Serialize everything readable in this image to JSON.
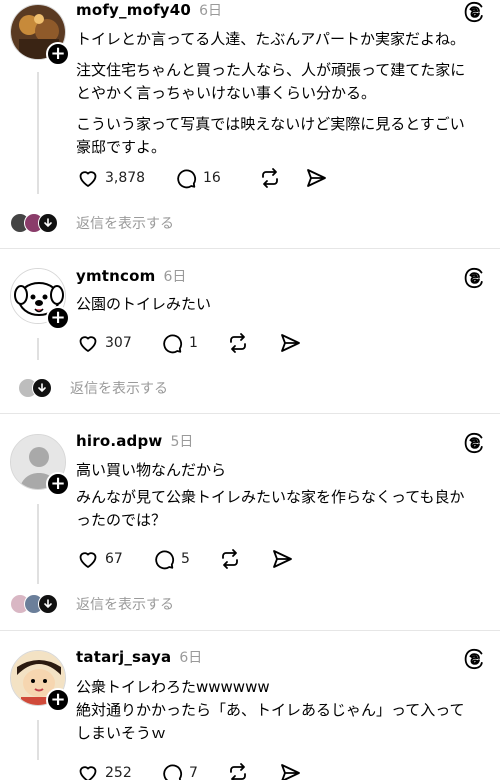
{
  "posts": [
    {
      "username": "mofy_mofy40",
      "time": "6日",
      "lines": [
        "トイレとか言ってる人達、たぶんアパートか実家だよね。",
        "注文住宅ちゃんと買った人なら、人が頑張って建てた家に",
        "とやかく言っちゃいけない事くらい分かる。",
        "こういう家って写真では映えないけど実際に見るとすごい",
        "豪邸ですよ。"
      ],
      "likes": "3,878",
      "comments": "16",
      "replies_label": "返信を表示する"
    },
    {
      "username": "ymtncom",
      "time": "6日",
      "lines": [
        "公園のトイレみたい"
      ],
      "likes": "307",
      "comments": "1",
      "replies_label": "返信を表示する"
    },
    {
      "username": "hiro.adpw",
      "time": "5日",
      "lines": [
        "高い買い物なんだから",
        "みんなが見て公衆トイレみたいな家を作らなくっても良か",
        "ったのでは？"
      ],
      "likes": "67",
      "comments": "5",
      "replies_label": "返信を表示する"
    },
    {
      "username": "tatarj_saya",
      "time": "6日",
      "lines": [
        "公衆トイレわろたwwwwww",
        "絶対通りかかったら「あ、トイレあるじゃん」って入って",
        "しまいそうｗ"
      ],
      "likes": "252",
      "comments": "7"
    }
  ],
  "icons": {
    "like": "heart-icon",
    "comment": "comment-bubble-icon",
    "repost": "repost-icon",
    "share": "send-icon",
    "brand": "threads-logo-icon",
    "follow": "plus-icon",
    "expand": "arrow-down-icon"
  },
  "colors": {
    "muted": "#9a9a9a",
    "divider": "#e6e6e6",
    "text": "#000000"
  }
}
